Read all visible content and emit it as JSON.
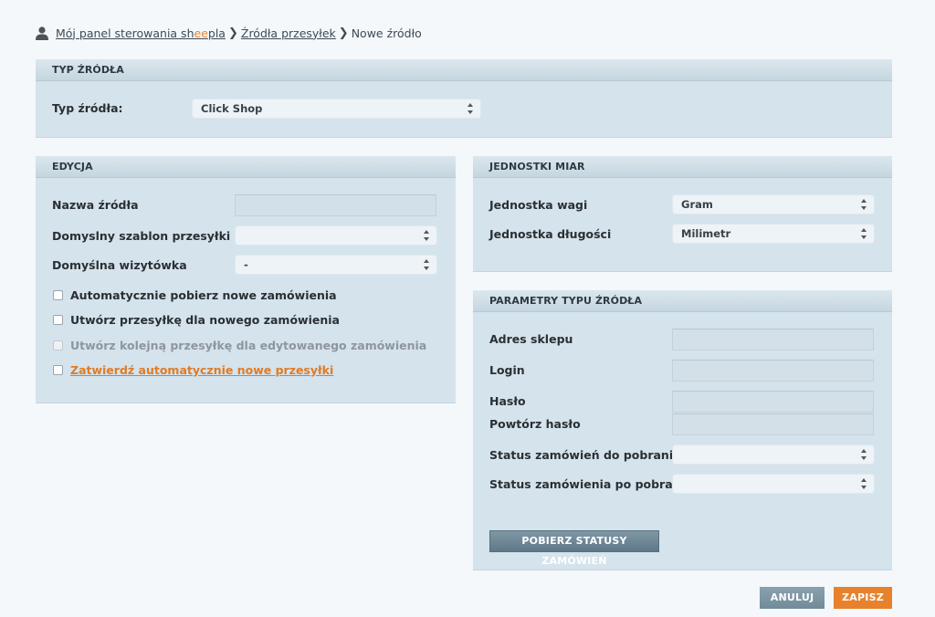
{
  "breadcrumb": {
    "item1_prefix": "Mój panel sterowania sh",
    "item1_accent": "ee",
    "item1_suffix": "pla",
    "item2": "Źródła przesyłek",
    "current": "Nowe źródło"
  },
  "source_type_panel": {
    "title": "TYP ŹRÓDŁA",
    "label": "Typ źródła:",
    "selected": "Click Shop"
  },
  "edit_panel": {
    "title": "EDYCJA",
    "name_label": "Nazwa źródła",
    "name_value": "",
    "template_label": "Domyslny szablon przesyłki",
    "template_selected": "",
    "card_label": "Domyślna wizytówka",
    "card_selected": "-",
    "checkboxes": [
      {
        "label": "Automatycznie pobierz nowe zamówienia",
        "checked": false
      },
      {
        "label": "Utwórz przesyłkę dla nowego zamówienia",
        "checked": false
      },
      {
        "label": "Utwórz kolejną przesyłkę dla edytowanego zamówienia",
        "checked": false,
        "disabled": true
      },
      {
        "label": "Zatwierdź automatycznie nowe przesyłki",
        "checked": false,
        "link": true
      }
    ]
  },
  "units_panel": {
    "title": "JEDNOSTKI MIAR",
    "weight_label": "Jednostka wagi",
    "weight_selected": "Gram",
    "length_label": "Jednostka długości",
    "length_selected": "Milimetr"
  },
  "params_panel": {
    "title": "PARAMETRY TYPU ŹRÓDŁA",
    "shop_address_label": "Adres sklepu",
    "login_label": "Login",
    "password_label": "Hasło",
    "password_repeat_label": "Powtórz hasło",
    "status_fetch_label": "Status zamówień do pobrania",
    "status_fetch_selected": "",
    "status_after_label": "Status zamówienia po pobraniu",
    "status_after_selected": "",
    "fetch_button": "POBIERZ STATUSY ZAMÓWIEŃ"
  },
  "actions": {
    "cancel": "ANULUJ",
    "save": "ZAPISZ"
  },
  "colors": {
    "accent": "#e8812c",
    "panel_bg": "#d4e3ec",
    "page_bg": "#f4f8fb"
  }
}
